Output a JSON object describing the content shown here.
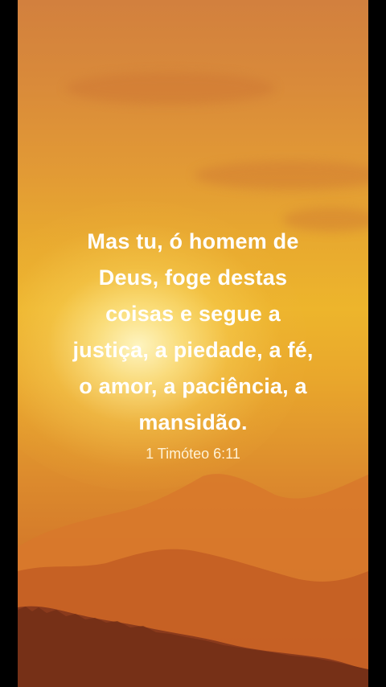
{
  "verse": {
    "lines": [
      "Mas tu, ó homem de",
      "Deus, foge destas",
      "coisas e segue a",
      "justiça, a piedade, a fé,",
      "o amor, a paciência, a",
      "mansidão."
    ],
    "reference": "1 Timóteo 6:11"
  },
  "colors": {
    "sky_top": "#d2803e",
    "sky_mid": "#edb52c",
    "mountain_far": "#d8782c",
    "mountain_mid": "#c45e24",
    "mountain_near": "#8a3a1c",
    "text": "#ffffff"
  }
}
